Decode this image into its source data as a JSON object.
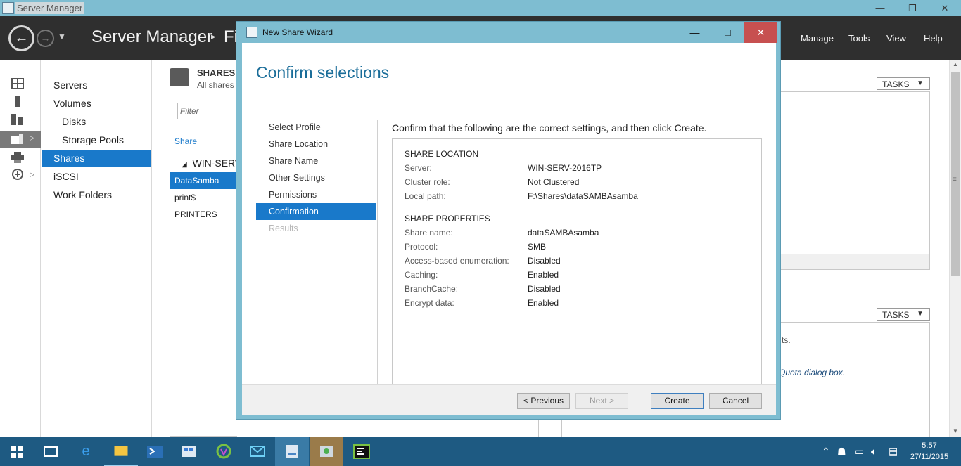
{
  "window": {
    "title": "Server Manager",
    "controls": {
      "minimize": "—",
      "restore": "❐",
      "close": "✕"
    }
  },
  "header": {
    "breadcrumb_app": "Server Manager",
    "breadcrumb_sep": "▸",
    "breadcrumb_section": "Fi",
    "menu": [
      "Manage",
      "Tools",
      "View",
      "Help"
    ]
  },
  "rail": {
    "icons": [
      "dashboard-icon",
      "local-server-icon",
      "all-servers-icon",
      "file-storage-icon",
      "print-services-icon",
      "remote-access-icon"
    ]
  },
  "nav": {
    "items": [
      {
        "label": "Servers",
        "sub": false
      },
      {
        "label": "Volumes",
        "sub": false
      },
      {
        "label": "Disks",
        "sub": true
      },
      {
        "label": "Storage Pools",
        "sub": true
      },
      {
        "label": "Shares",
        "sub": false,
        "selected": true
      },
      {
        "label": "iSCSI",
        "sub": false
      },
      {
        "label": "Work Folders",
        "sub": false
      }
    ]
  },
  "shares": {
    "title": "SHARES",
    "subtitle": "All shares",
    "filter_placeholder": "Filter",
    "column_header": "Share",
    "group": "WIN-SERV",
    "rows": [
      "DataSamba",
      "print$",
      "PRINTERS"
    ],
    "selected_row": "DataSamba"
  },
  "right_panes": {
    "tasks_label": "TASKS",
    "text_fragment_1": "ts.",
    "text_fragment_2": "Quota dialog box."
  },
  "wizard": {
    "title": "New Share Wizard",
    "heading": "Confirm selections",
    "steps": [
      {
        "label": "Select Profile",
        "state": "normal"
      },
      {
        "label": "Share Location",
        "state": "normal"
      },
      {
        "label": "Share Name",
        "state": "normal"
      },
      {
        "label": "Other Settings",
        "state": "normal"
      },
      {
        "label": "Permissions",
        "state": "normal"
      },
      {
        "label": "Confirmation",
        "state": "selected"
      },
      {
        "label": "Results",
        "state": "disabled"
      }
    ],
    "instruction": "Confirm that the following are the correct settings, and then click Create.",
    "share_location": {
      "heading": "SHARE LOCATION",
      "rows": [
        {
          "label": "Server:",
          "value": "WIN-SERV-2016TP"
        },
        {
          "label": "Cluster role:",
          "value": "Not Clustered"
        },
        {
          "label": "Local path:",
          "value": "F:\\Shares\\dataSAMBAsamba"
        }
      ]
    },
    "share_properties": {
      "heading": "SHARE PROPERTIES",
      "rows": [
        {
          "label": "Share name:",
          "value": "dataSAMBAsamba"
        },
        {
          "label": "Protocol:",
          "value": "SMB"
        },
        {
          "label": "Access-based enumeration:",
          "value": "Disabled"
        },
        {
          "label": "Caching:",
          "value": "Enabled"
        },
        {
          "label": "BranchCache:",
          "value": "Disabled"
        },
        {
          "label": "Encrypt data:",
          "value": "Enabled"
        }
      ]
    },
    "buttons": {
      "previous": "< Previous",
      "next": "Next >",
      "create": "Create",
      "cancel": "Cancel"
    },
    "controls": {
      "minimize": "—",
      "maximize": "□",
      "close": "✕"
    }
  },
  "taskbar": {
    "apps": [
      "windows-start-icon",
      "task-view-icon",
      "edge-icon",
      "file-explorer-icon",
      "powershell-icon",
      "control-panel-icon",
      "app-green-icon",
      "mail-icon",
      "server-manager-icon",
      "network-app-icon",
      "terminal-icon"
    ],
    "tray_icons": [
      "chevron-up-icon",
      "people-icon",
      "network-icon",
      "volume-icon",
      "action-center-icon"
    ],
    "time": "5:57",
    "date": "27/11/2015"
  }
}
